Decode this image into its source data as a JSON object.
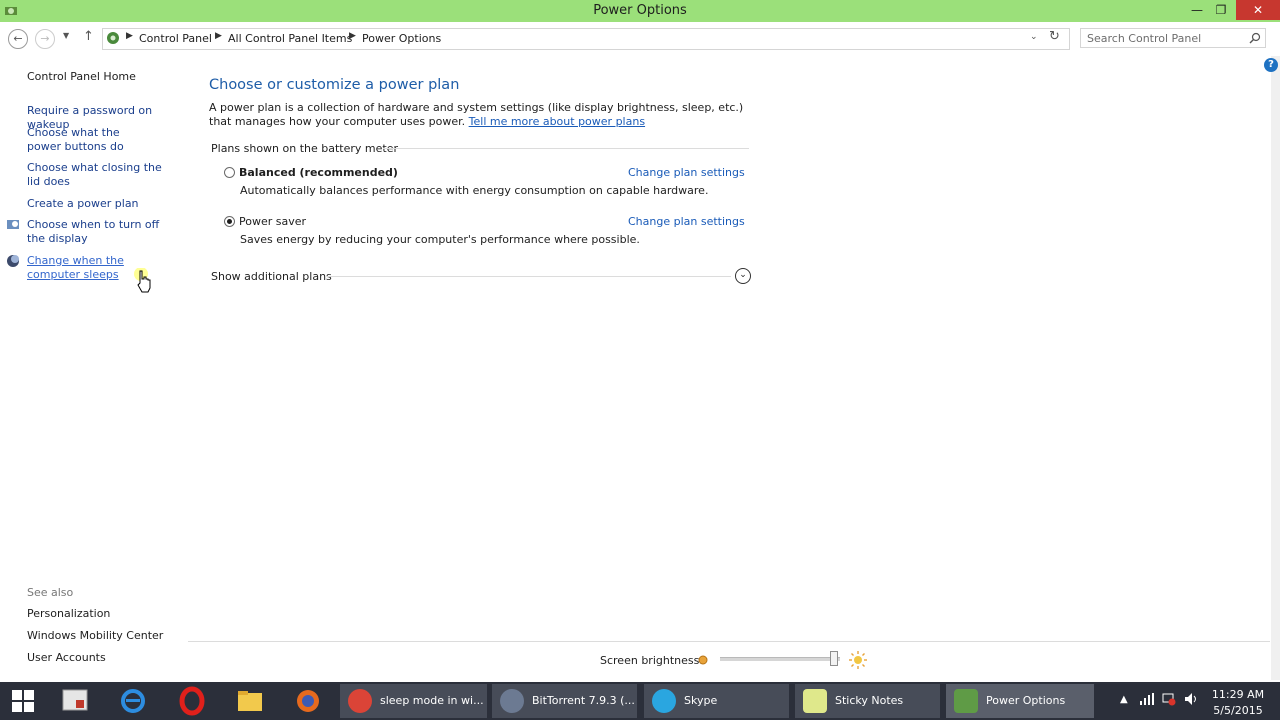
{
  "window": {
    "title": "Power Options",
    "minimize": "—",
    "restore": "❐",
    "close": "✕"
  },
  "address": {
    "crumbs": [
      "Control Panel",
      "All Control Panel Items",
      "Power Options"
    ],
    "search_placeholder": "Search Control Panel"
  },
  "sidebar": {
    "home": "Control Panel Home",
    "links": [
      "Require a password on wakeup",
      "Choose what the power buttons do",
      "Choose what closing the lid does",
      "Create a power plan",
      "Choose when to turn off the display",
      "Change when the computer sleeps"
    ],
    "see_also_label": "See also",
    "see_also": [
      "Personalization",
      "Windows Mobility Center",
      "User Accounts"
    ]
  },
  "main": {
    "title": "Choose or customize a power plan",
    "description": "A power plan is a collection of hardware and system settings (like display brightness, sleep, etc.) that manages how your computer uses power.",
    "learn_more": "Tell me more about power plans",
    "plans_header": "Plans shown on the battery meter",
    "plans": [
      {
        "name": "Balanced (recommended)",
        "desc": "Automatically balances performance with energy consumption on capable hardware.",
        "selected": false,
        "link": "Change plan settings"
      },
      {
        "name": "Power saver",
        "desc": "Saves energy by reducing your computer's performance where possible.",
        "selected": true,
        "link": "Change plan settings"
      }
    ],
    "additional_plans": "Show additional plans"
  },
  "brightness": {
    "label": "Screen brightness:",
    "level_percent": 95
  },
  "taskbar": {
    "tasks": [
      "sleep mode in wi...",
      "BitTorrent 7.9.3  (...",
      "Skype",
      "Sticky Notes",
      "Power Options"
    ],
    "time": "11:29 AM",
    "date": "5/5/2015"
  },
  "colors": {
    "titlebar": "#9be07a",
    "link": "#1a5bb8",
    "heading": "#1e5da8",
    "taskbar": "#2b2f3a"
  }
}
